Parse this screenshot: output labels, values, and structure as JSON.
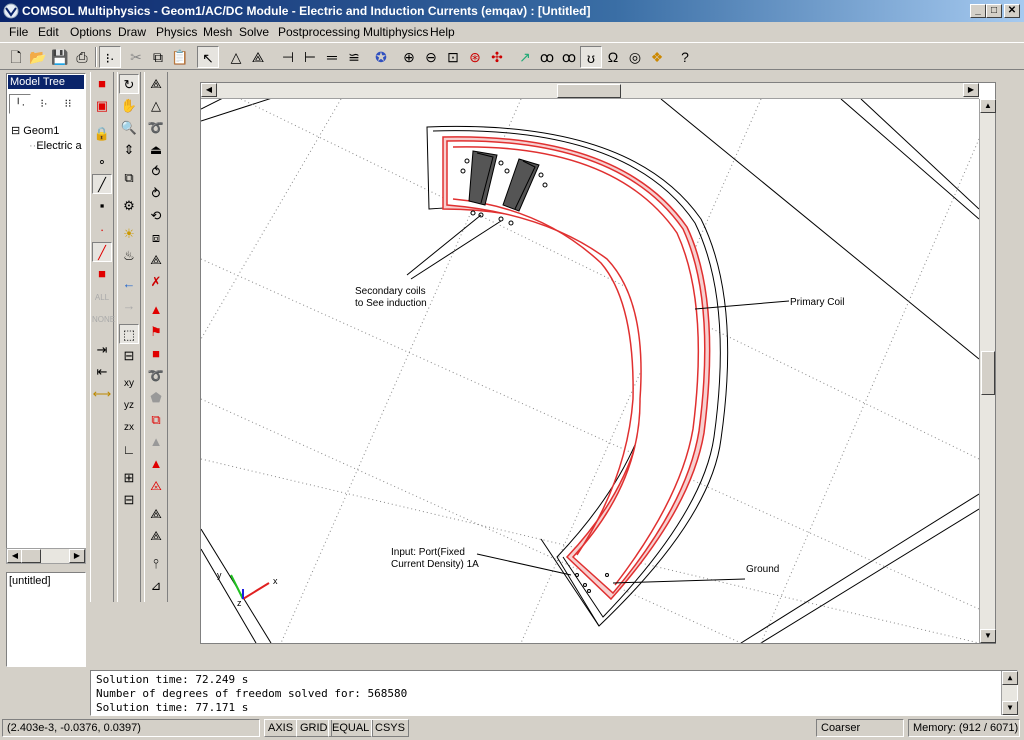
{
  "window": {
    "title": "COMSOL Multiphysics - Geom1/AC/DC Module - Electric and Induction Currents (emqav) : [Untitled]",
    "minimize": "_",
    "maximize": "□",
    "close": "✕"
  },
  "menu": [
    "File",
    "Edit",
    "Options",
    "Draw",
    "Physics",
    "Mesh",
    "Solve",
    "Postprocessing",
    "Multiphysics",
    "Help"
  ],
  "toolbar": {
    "icons": [
      "new-icon",
      "open-icon",
      "save-icon",
      "print-icon",
      "model-tree-icon",
      "cut-icon",
      "copy-icon",
      "paste-icon",
      "select-icon",
      "mesh-triangle-icon",
      "mesh-refine-icon",
      "boundary-settings-icon",
      "subdomain-settings-icon",
      "equation-icon",
      "scalar-expression-icon",
      "solve-icon",
      "zoom-in-icon",
      "zoom-out-icon",
      "zoom-window-icon",
      "zoom-extents-icon",
      "move-icon",
      "plot-parameters-icon",
      "animate-icon",
      "deformed-icon",
      "solver-icon",
      "ohm-icon",
      "sphere-icon",
      "mesh-color-icon",
      "help-icon"
    ]
  },
  "model_tree": {
    "header": "Model Tree",
    "view_buttons": [
      "╵·",
      "⁝·",
      "⁝⁝"
    ],
    "nodes": [
      {
        "label": "Geom1",
        "expander": "⊟"
      },
      {
        "label": "Electric a"
      }
    ]
  },
  "notes": {
    "text": "[untitled]"
  },
  "drawing": {
    "labels": {
      "secondary": "Secondary coils\nto See induction",
      "primary": "Primary Coil",
      "input": "Input: Port(Fixed\nCurrent Density) 1A",
      "ground": "Ground"
    },
    "axes": {
      "x": "x",
      "y": "y",
      "z": "z"
    },
    "colors": {
      "coil": "#e03030",
      "coil_fill": "#f4a0a0",
      "x_axis": "#e02020",
      "y_axis": "#20c020",
      "z_axis": "#2020e0"
    }
  },
  "log": {
    "lines": [
      "Solution time: 72.249 s",
      "Number of degrees of freedom solved for: 568580",
      "Solution time: 77.171 s"
    ]
  },
  "status": {
    "coords": "(2.403e-3, -0.0376, 0.0397)",
    "buttons": [
      "AXIS",
      "GRID",
      "EQUAL",
      "CSYS"
    ],
    "mesh": "Coarser",
    "memory": "Memory: (912 / 6071)"
  }
}
